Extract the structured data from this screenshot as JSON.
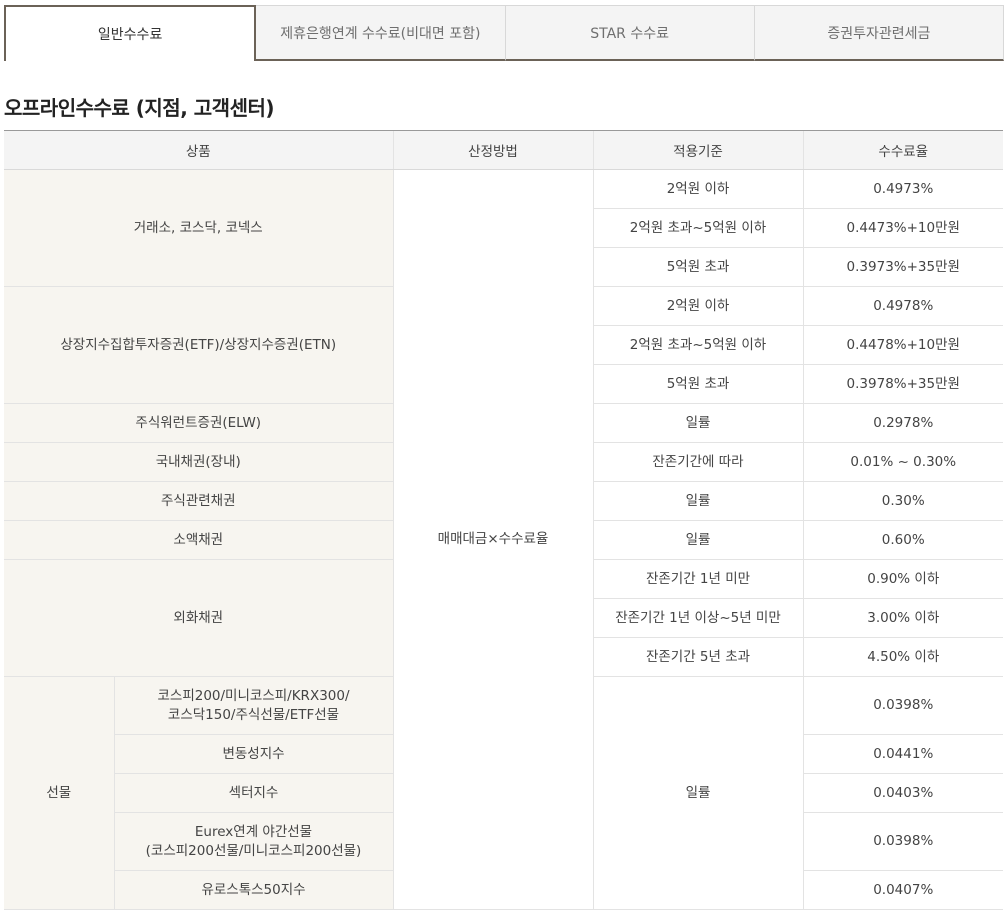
{
  "tabs": [
    "일반수수료",
    "제휴은행연계 수수료(비대면 포함)",
    "STAR 수수료",
    "증권투자관련세금"
  ],
  "section_title": "오프라인수수료 (지점, 고객센터)",
  "table": {
    "headers": [
      "상품",
      "산정방법",
      "적용기준",
      "수수료율"
    ],
    "method": "매매대금×수수료율",
    "groups": [
      {
        "product": "거래소, 코스닥, 코넥스",
        "rows": [
          {
            "basis": "2억원 이하",
            "rate": "0.4973%"
          },
          {
            "basis": "2억원 초과~5억원 이하",
            "rate": "0.4473%+10만원"
          },
          {
            "basis": "5억원 초과",
            "rate": "0.3973%+35만원"
          }
        ]
      },
      {
        "product": "상장지수집합투자증권(ETF)/상장지수증권(ETN)",
        "rows": [
          {
            "basis": "2억원 이하",
            "rate": "0.4978%"
          },
          {
            "basis": "2억원 초과~5억원 이하",
            "rate": "0.4478%+10만원"
          },
          {
            "basis": "5억원 초과",
            "rate": "0.3978%+35만원"
          }
        ]
      },
      {
        "product": "주식워런트증권(ELW)",
        "rows": [
          {
            "basis": "일률",
            "rate": "0.2978%"
          }
        ]
      },
      {
        "product": "국내채권(장내)",
        "rows": [
          {
            "basis": "잔존기간에 따라",
            "rate": "0.01% ~ 0.30%"
          }
        ]
      },
      {
        "product": "주식관련채권",
        "rows": [
          {
            "basis": "일률",
            "rate": "0.30%"
          }
        ]
      },
      {
        "product": "소액채권",
        "rows": [
          {
            "basis": "일률",
            "rate": "0.60%"
          }
        ]
      },
      {
        "product": "외화채권",
        "rows": [
          {
            "basis": "잔존기간 1년 미만",
            "rate": "0.90% 이하"
          },
          {
            "basis": "잔존기간 1년 이상~5년 미만",
            "rate": "3.00% 이하"
          },
          {
            "basis": "잔존기간 5년 초과",
            "rate": "4.50% 이하"
          }
        ]
      }
    ],
    "futures": {
      "label": "선물",
      "basis": "일률",
      "rows": [
        {
          "name": "코스피200/미니코스피/KRX300/\n코스닥150/주식선물/ETF선물",
          "rate": "0.0398%",
          "tall": true
        },
        {
          "name": "변동성지수",
          "rate": "0.0441%",
          "tall": false
        },
        {
          "name": "섹터지수",
          "rate": "0.0403%",
          "tall": false
        },
        {
          "name": "Eurex연계 야간선물\n(코스피200선물/미니코스피200선물)",
          "rate": "0.0398%",
          "tall": true
        },
        {
          "name": "유로스톡스50지수",
          "rate": "0.0407%",
          "tall": false
        }
      ]
    }
  }
}
